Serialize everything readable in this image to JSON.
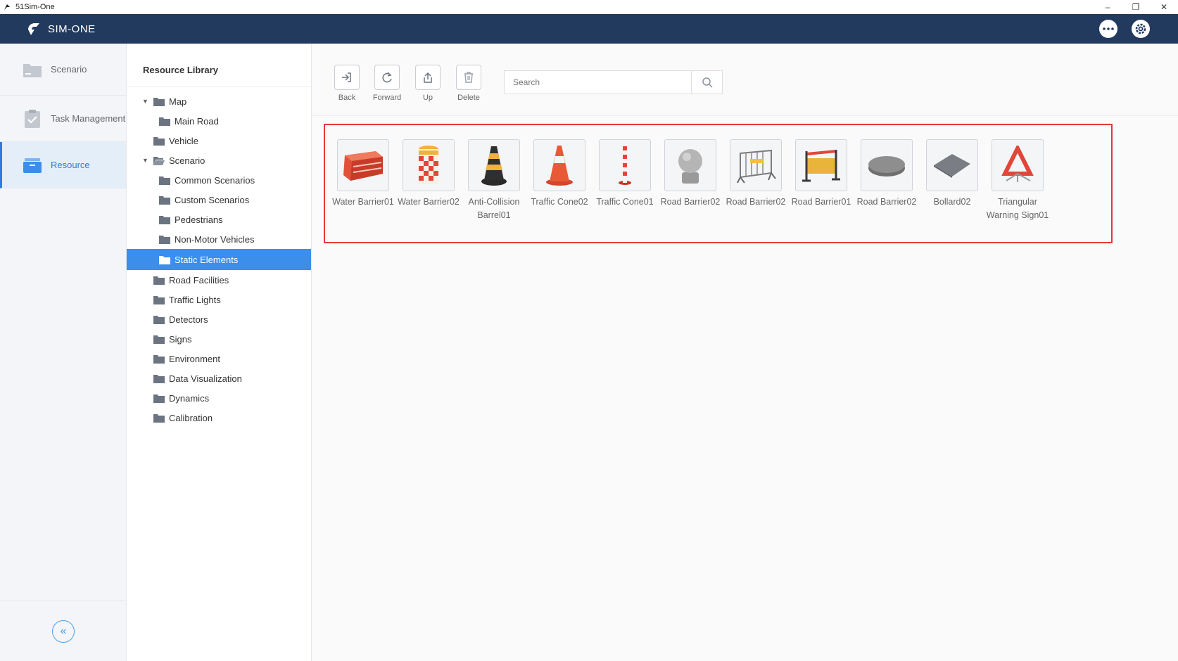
{
  "os_window": {
    "title": "51Sim-One",
    "minimize": "–",
    "restore": "❐",
    "close": "✕"
  },
  "header": {
    "app_name": "SIM-ONE"
  },
  "nav": {
    "items": [
      {
        "label": "Scenario"
      },
      {
        "label": "Task Management"
      },
      {
        "label": "Resource"
      }
    ],
    "collapse_glyph": "«"
  },
  "tree": {
    "title": "Resource Library",
    "items": [
      {
        "label": "Map"
      },
      {
        "label": "Main Road"
      },
      {
        "label": "Vehicle"
      },
      {
        "label": "Scenario"
      },
      {
        "label": "Common Scenarios"
      },
      {
        "label": "Custom Scenarios"
      },
      {
        "label": "Pedestrians"
      },
      {
        "label": "Non-Motor Vehicles"
      },
      {
        "label": "Static Elements"
      },
      {
        "label": "Road Facilities"
      },
      {
        "label": "Traffic Lights"
      },
      {
        "label": "Detectors"
      },
      {
        "label": "Signs"
      },
      {
        "label": "Environment"
      },
      {
        "label": "Data Visualization"
      },
      {
        "label": "Dynamics"
      },
      {
        "label": "Calibration"
      }
    ]
  },
  "toolbar": {
    "back": "Back",
    "forward": "Forward",
    "up": "Up",
    "delete": "Delete",
    "search_placeholder": "Search"
  },
  "assets": [
    {
      "label": "Water Barrier01",
      "icon": "water-barrier-red"
    },
    {
      "label": "Water Barrier02",
      "icon": "water-barrier-checker"
    },
    {
      "label": "Anti-Collision Barrel01",
      "icon": "anti-collision-barrel"
    },
    {
      "label": "Traffic Cone02",
      "icon": "traffic-cone"
    },
    {
      "label": "Traffic Cone01",
      "icon": "traffic-post"
    },
    {
      "label": "Road Barrier02",
      "icon": "stone-ball"
    },
    {
      "label": "Road Barrier02",
      "icon": "fence-grey"
    },
    {
      "label": "Road Barrier01",
      "icon": "fence-yellow"
    },
    {
      "label": "Road Barrier02",
      "icon": "disc"
    },
    {
      "label": "Bollard02",
      "icon": "plate"
    },
    {
      "label": "Triangular Warning Sign01",
      "icon": "warning-triangle"
    }
  ],
  "colors": {
    "header_bg": "#223a5e",
    "accent": "#3b8eea",
    "highlight_border": "#e53935"
  }
}
